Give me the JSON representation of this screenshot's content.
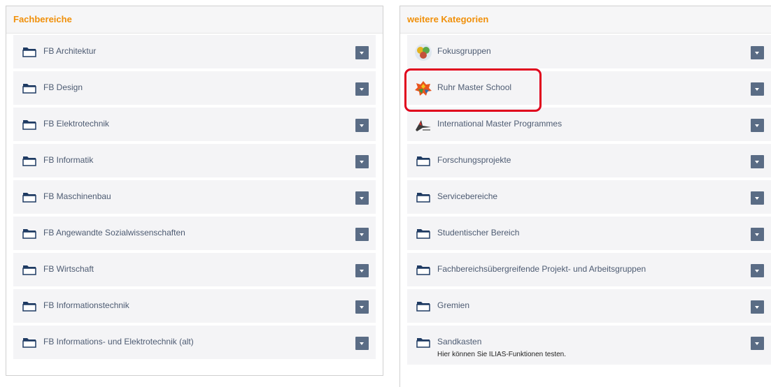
{
  "left_panel": {
    "title": "Fachbereiche",
    "items": [
      {
        "label": "FB Architektur",
        "icon": "folder-icon"
      },
      {
        "label": "FB Design",
        "icon": "folder-icon"
      },
      {
        "label": "FB Elektrotechnik",
        "icon": "folder-icon"
      },
      {
        "label": "FB Informatik",
        "icon": "folder-icon"
      },
      {
        "label": "FB Maschinenbau",
        "icon": "folder-icon"
      },
      {
        "label": "FB Angewandte Sozialwissenschaften",
        "icon": "folder-icon"
      },
      {
        "label": "FB Wirtschaft",
        "icon": "folder-icon"
      },
      {
        "label": "FB Informationstechnik",
        "icon": "folder-icon"
      },
      {
        "label": "FB Informations- und Elektrotechnik (alt)",
        "icon": "folder-icon"
      }
    ]
  },
  "right_panel": {
    "title": "weitere Kategorien",
    "items": [
      {
        "label": "Fokusgruppen",
        "icon": "fokusgruppen-logo-icon"
      },
      {
        "label": "Ruhr Master School",
        "icon": "ruhr-master-school-logo-icon",
        "highlighted": true
      },
      {
        "label": "International Master Programmes",
        "icon": "international-master-logo-icon"
      },
      {
        "label": "Forschungsprojekte",
        "icon": "folder-icon"
      },
      {
        "label": "Servicebereiche",
        "icon": "folder-icon"
      },
      {
        "label": "Studentischer Bereich",
        "icon": "folder-icon"
      },
      {
        "label": "Fachbereichsübergreifende Projekt- und Arbeitsgruppen",
        "icon": "folder-icon"
      },
      {
        "label": "Gremien",
        "icon": "folder-icon"
      },
      {
        "label": "Sandkasten",
        "icon": "folder-icon",
        "description": "Hier können Sie ILIAS-Funktionen testen."
      }
    ]
  },
  "colors": {
    "heading": "#f0900a",
    "row_background": "#f4f4f6",
    "dropdown_button": "#5a6c85",
    "label_text": "#4d5b72",
    "highlight": "#e0001c"
  }
}
